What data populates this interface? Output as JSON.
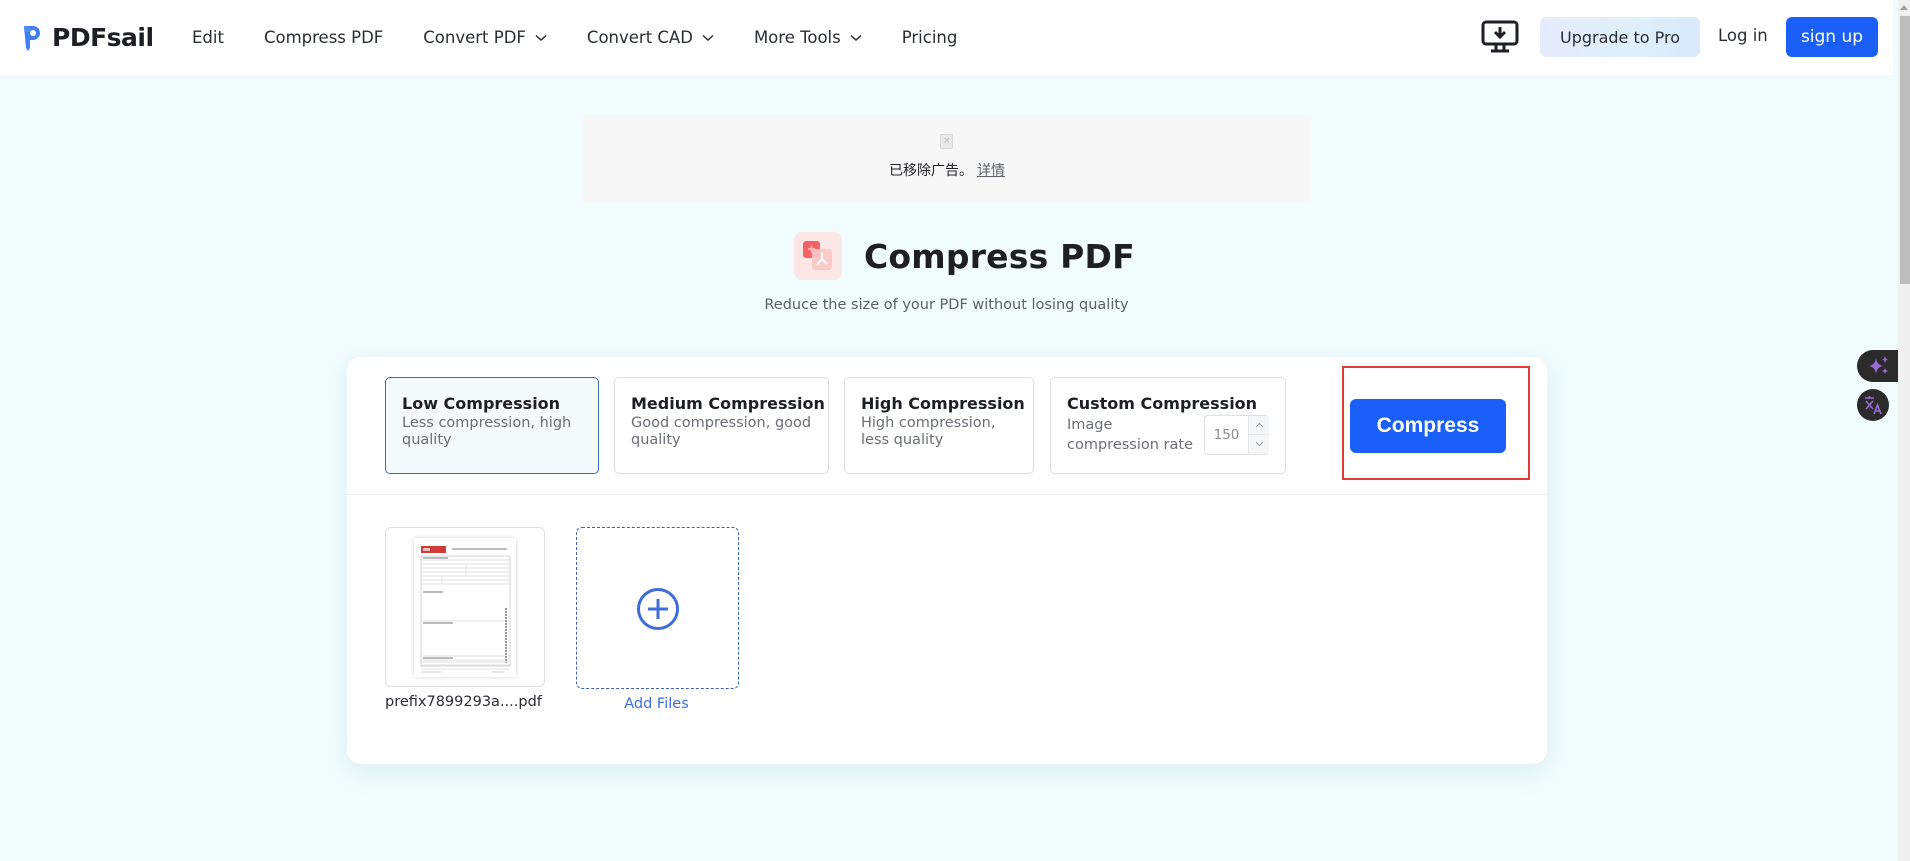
{
  "header": {
    "logo_text": "PDFsail",
    "nav": [
      {
        "label": "Edit",
        "has_dropdown": false
      },
      {
        "label": "Compress PDF",
        "has_dropdown": false
      },
      {
        "label": "Convert PDF",
        "has_dropdown": true
      },
      {
        "label": "Convert CAD",
        "has_dropdown": true
      },
      {
        "label": "More Tools",
        "has_dropdown": true
      },
      {
        "label": "Pricing",
        "has_dropdown": false
      }
    ],
    "desktop_icon": "desktop-download-icon",
    "upgrade_label": "Upgrade to Pro",
    "login_label": "Log in",
    "signup_label": "sign up"
  },
  "ad": {
    "icon": "broken-image-icon",
    "text": "已移除广告。",
    "link": "详情"
  },
  "page": {
    "title": "Compress PDF",
    "subtitle": "Reduce the size of your PDF without losing quality",
    "title_icon": "compress-pdf-icon"
  },
  "options": [
    {
      "title": "Low Compression",
      "desc": "Less compression, high quality",
      "selected": true
    },
    {
      "title": "Medium Compression",
      "desc": "Good compression, good quality",
      "selected": false
    },
    {
      "title": "High Compression",
      "desc": "High compression, less quality",
      "selected": false
    },
    {
      "title": "Custom Compression",
      "desc": "Image compression rate",
      "value": "150",
      "selected": false
    }
  ],
  "compress_label": "Compress",
  "files": [
    {
      "name": "prefix7899293a....pdf"
    }
  ],
  "add_files_label": "Add Files",
  "colors": {
    "primary": "#1a5ff8",
    "highlight": "#e03a3a",
    "background": "#f1fcfd",
    "accent_link": "#3d6ed8"
  },
  "floating": {
    "ai_icon": "sparkle-icon",
    "translate_icon": "translate-icon"
  }
}
